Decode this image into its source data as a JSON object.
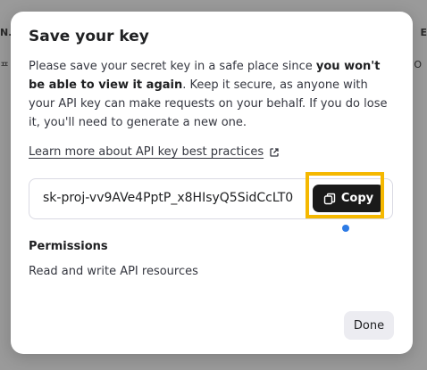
{
  "background": {
    "left_top": "N.",
    "left_second": "ᄑ",
    "right_top": "E",
    "right_second": "O"
  },
  "modal": {
    "title": "Save your key",
    "desc_part1": "Please save your secret key in a safe place since ",
    "desc_bold": "you won't be able to view it again",
    "desc_part2": ". Keep it secure, as anyone with your API key can make requests on your behalf. If you do lose it, you'll need to generate a new one.",
    "learn_link": "Learn more about API key best practices",
    "secret_key": "sk-proj-vv9AVe4PptP_x8HIsyQ5SidCcLT0",
    "copy_label": "Copy",
    "permissions_heading": "Permissions",
    "permissions_value": "Read and write API resources",
    "done_label": "Done"
  },
  "colors": {
    "highlight": "#f5b800",
    "copy_button_bg": "#1a1a1a",
    "indicator_dot": "#2d7be5",
    "overlay": "#9a9a9a"
  },
  "icons": {
    "external_link": "external-link-icon",
    "copy": "copy-icon"
  }
}
